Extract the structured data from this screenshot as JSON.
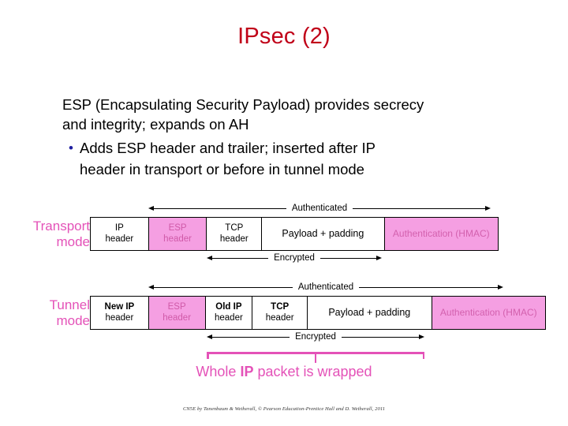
{
  "slide": {
    "title": "IPsec (2)",
    "title_color": "#C00018",
    "accent_pink": "#E452B8",
    "fill_pink": "#F59FE2"
  },
  "body": {
    "lead_line1": "ESP (Encapsulating Security Payload) provides secrecy",
    "lead_line2": "and integrity; expands on AH",
    "bullet_glyph": "•",
    "bullet_line1": "Adds ESP header and trailer; inserted after IP",
    "bullet_line2": "header in transport or before in tunnel mode"
  },
  "diagram": {
    "transport": {
      "label_line1": "Transport",
      "label_line2": "mode",
      "authenticated_label": "Authenticated",
      "encrypted_label": "Encrypted",
      "cells": [
        {
          "l1": "IP",
          "l2": "header",
          "style": "plain"
        },
        {
          "l1": "ESP",
          "l2": "header",
          "style": "pink"
        },
        {
          "l1": "TCP",
          "l2": "header",
          "style": "plain"
        },
        {
          "l1": "Payload + padding",
          "l2": "",
          "style": "plain"
        },
        {
          "l1": "Authentication (HMAC)",
          "l2": "",
          "style": "pink-hmac"
        }
      ]
    },
    "tunnel": {
      "label_line1": "Tunnel",
      "label_line2": "mode",
      "authenticated_label": "Authenticated",
      "encrypted_label": "Encrypted",
      "cells": [
        {
          "l1": "New IP",
          "l2": "header",
          "style": "semibold"
        },
        {
          "l1": "ESP",
          "l2": "header",
          "style": "pink"
        },
        {
          "l1": "Old IP",
          "l2": "header",
          "style": "semibold"
        },
        {
          "l1": "TCP",
          "l2": "header",
          "style": "semibold"
        },
        {
          "l1": "Payload + padding",
          "l2": "",
          "style": "plain"
        },
        {
          "l1": "Authentication (HMAC)",
          "l2": "",
          "style": "pink-hmac"
        }
      ]
    },
    "wrap_note_a": "Whole ",
    "wrap_note_b": "IP",
    "wrap_note_c": " packet is wrapped"
  },
  "footer": {
    "credit": "CN5E by Tanenbaum & Wetherall, © Pearson Education-Prentice Hall and D. Wetherall, 2011"
  }
}
